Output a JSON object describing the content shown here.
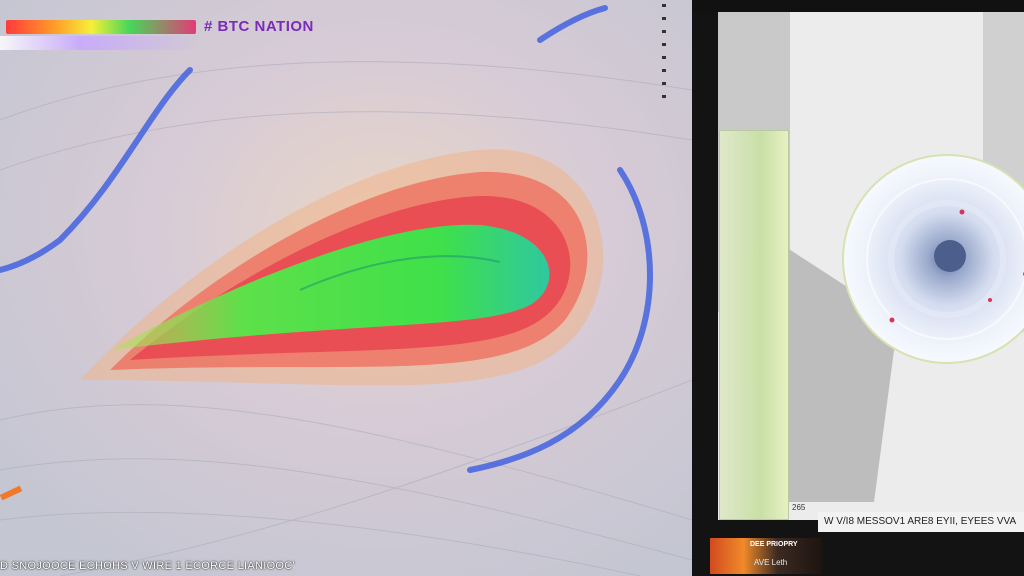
{
  "colors": {
    "laminar_core": "#3fe04a",
    "warm_band": "#f06a4a",
    "cool_edge": "#3a5be0",
    "title_text": "#7b2bb8"
  },
  "viewport": {
    "title": "# BTC NATION",
    "bottom_caption": "D SNOJOOCE ECHOHS V WIRE 1 ECORCE LIANIOOC'"
  },
  "side_panel": {
    "legend_rows": [
      "",
      "",
      "",
      "",
      "",
      "",
      "",
      "",
      "",
      "",
      "",
      "",
      "",
      ""
    ],
    "number_label": "265",
    "status_text": "W V/I8 MESSOV1 ARE8 EYII, EYEES VVA",
    "thumbnail": {
      "label_top": "DEE PRIOPRY",
      "label_bottom": "AVE Leth"
    }
  },
  "icons": {
    "globe": "sphere-visualization-icon"
  }
}
